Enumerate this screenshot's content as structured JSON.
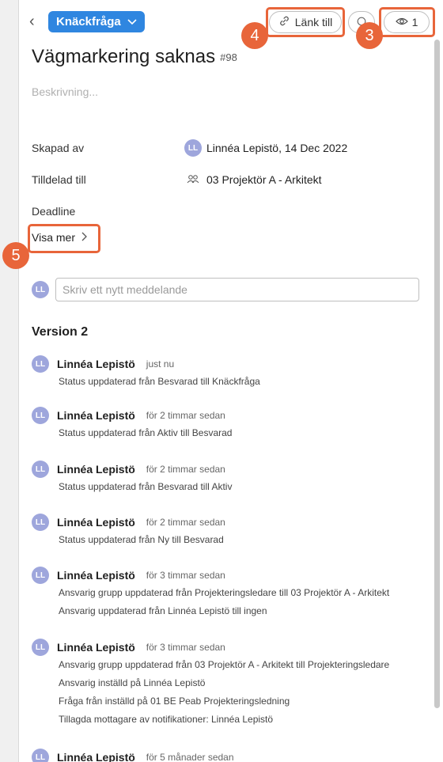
{
  "header": {
    "back_glyph": "‹",
    "status_label": "Knäckfråga",
    "link_label": "Länk till",
    "watch_count": "1"
  },
  "annotations": {
    "badge_3": "3",
    "badge_4": "4",
    "badge_5": "5",
    "color": "#e8653a"
  },
  "issue": {
    "title": "Vägmarkering saknas",
    "id": "#98",
    "description_placeholder": "Beskrivning..."
  },
  "fields": {
    "created_label": "Skapad av",
    "created_initials": "LL",
    "created_value": "Linnéa Lepistö, 14 Dec 2022",
    "assigned_label": "Tilldelad till",
    "assigned_value": "03 Projektör A - Arkitekt",
    "deadline_label": "Deadline",
    "show_more": "Visa mer"
  },
  "composer": {
    "initials": "LL",
    "placeholder": "Skriv ett nytt meddelande"
  },
  "history": {
    "version_title": "Version 2",
    "entries": [
      {
        "initials": "LL",
        "name": "Linnéa Lepistö",
        "time": "just nu",
        "lines": [
          "Status uppdaterad från Besvarad till Knäckfråga"
        ]
      },
      {
        "initials": "LL",
        "name": "Linnéa Lepistö",
        "time": "för 2 timmar sedan",
        "lines": [
          "Status uppdaterad från Aktiv till Besvarad"
        ]
      },
      {
        "initials": "LL",
        "name": "Linnéa Lepistö",
        "time": "för 2 timmar sedan",
        "lines": [
          "Status uppdaterad från Besvarad till Aktiv"
        ]
      },
      {
        "initials": "LL",
        "name": "Linnéa Lepistö",
        "time": "för 2 timmar sedan",
        "lines": [
          "Status uppdaterad från Ny till Besvarad"
        ]
      },
      {
        "initials": "LL",
        "name": "Linnéa Lepistö",
        "time": "för 3 timmar sedan",
        "lines": [
          "Ansvarig grupp uppdaterad från Projekteringsledare till 03 Projektör A - Arkitekt",
          "Ansvarig uppdaterad från Linnéa Lepistö till ingen"
        ]
      },
      {
        "initials": "LL",
        "name": "Linnéa Lepistö",
        "time": "för 3 timmar sedan",
        "lines": [
          "Ansvarig grupp uppdaterad från 03 Projektör A - Arkitekt till Projekteringsledare",
          "Ansvarig inställd på Linnéa Lepistö",
          "Fråga från inställd på 01 BE Peab Projekteringsledning",
          "Tillagda mottagare av notifikationer: Linnéa Lepistö"
        ]
      },
      {
        "initials": "LL",
        "name": "Linnéa Lepistö",
        "time": "för 5 månader sedan",
        "lines": []
      }
    ]
  }
}
